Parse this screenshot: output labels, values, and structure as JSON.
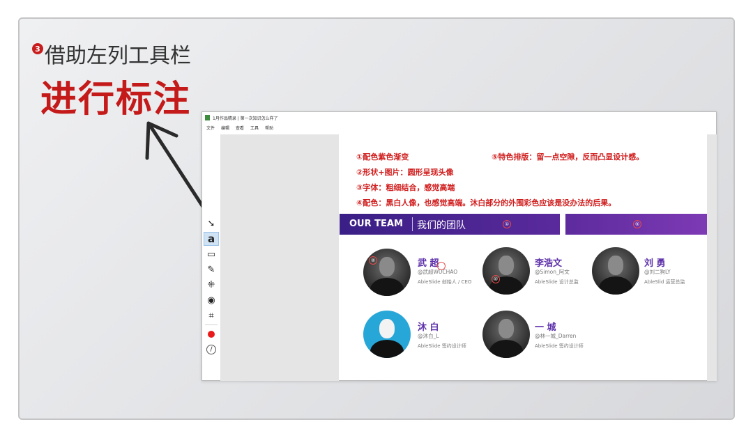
{
  "slide": {
    "step_badge": "3",
    "step_title": "借助左列工具栏",
    "big_title": "进行标注"
  },
  "window": {
    "title": "1月作品精录 | 第一次知识怎么样了",
    "menu": [
      "文件",
      "编辑",
      "查看",
      "工具",
      "帮助"
    ]
  },
  "toolbar": {
    "tools": [
      "arrow-tool",
      "text-tool",
      "rectangle-tool",
      "pen-tool",
      "mosaic-tool",
      "blur-tool",
      "crop-tool"
    ],
    "text_tool_label": "a",
    "color": "#e81a1a"
  },
  "annotations": {
    "note1": "①配色紫色渐变",
    "note2": "②形状+图片：圆形呈现头像",
    "note3": "③字体：粗细结合，感觉高端",
    "note4": "④配色：黑白人像，也感觉高端。沐白部分的外围彩色应该是没办法的后果。",
    "note5": "⑤特色排版：留一点空隙，反而凸显设计感。",
    "marker_1": "①",
    "marker_2": "②",
    "marker_3": "③",
    "marker_4": "④",
    "marker_5": "⑤"
  },
  "team": {
    "title_en": "OUR TEAM",
    "title_cn": "我们的团队",
    "members": [
      {
        "name": "武 超",
        "handle": "@武超WUCHAO",
        "role": "AbleSlide 创始人 / CEO"
      },
      {
        "name": "李浩文",
        "handle": "@Simon_阿文",
        "role": "AbleSlide 设计总监"
      },
      {
        "name": "刘 勇",
        "handle": "@刘二狗LY",
        "role": "AbleSlid 运营总监"
      },
      {
        "name": "沐 白",
        "handle": "@沐白_L",
        "role": "AbleSlide 签约设计师"
      },
      {
        "name": "一 城",
        "handle": "@林一城_Darren",
        "role": "AbleSlide 签约设计师"
      }
    ]
  },
  "colors": {
    "accent_red": "#c41a1a",
    "team_purple": "#5a2a9c"
  }
}
